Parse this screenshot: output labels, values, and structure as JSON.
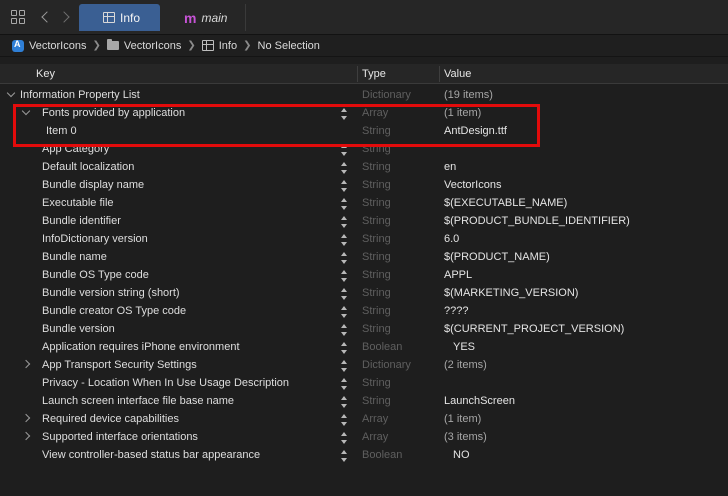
{
  "tabs": [
    {
      "label": "Info",
      "active": true,
      "icon": "table-icon"
    },
    {
      "label": "main",
      "active": false,
      "icon": "m-file-icon",
      "icon_glyph": "m"
    }
  ],
  "breadcrumb": [
    "VectorIcons",
    "VectorIcons",
    "Info",
    "No Selection"
  ],
  "columns": {
    "key": "Key",
    "type": "Type",
    "value": "Value"
  },
  "rows": [
    {
      "key": "Information Property List",
      "type": "Dictionary",
      "value": "(19 items)",
      "level": 0,
      "disclosure": "open"
    },
    {
      "key": "Fonts provided by application",
      "type": "Array",
      "value": "(1 item)",
      "level": 1,
      "disclosure": "open"
    },
    {
      "key": "Item 0",
      "type": "String",
      "value": "AntDesign.ttf",
      "level": 2
    },
    {
      "key": "App Category",
      "type": "String",
      "value": "",
      "level": 1
    },
    {
      "key": "Default localization",
      "type": "String",
      "value": "en",
      "level": 1
    },
    {
      "key": "Bundle display name",
      "type": "String",
      "value": "VectorIcons",
      "level": 1
    },
    {
      "key": "Executable file",
      "type": "String",
      "value": "$(EXECUTABLE_NAME)",
      "level": 1
    },
    {
      "key": "Bundle identifier",
      "type": "String",
      "value": "$(PRODUCT_BUNDLE_IDENTIFIER)",
      "level": 1
    },
    {
      "key": "InfoDictionary version",
      "type": "String",
      "value": "6.0",
      "level": 1
    },
    {
      "key": "Bundle name",
      "type": "String",
      "value": "$(PRODUCT_NAME)",
      "level": 1
    },
    {
      "key": "Bundle OS Type code",
      "type": "String",
      "value": "APPL",
      "level": 1
    },
    {
      "key": "Bundle version string (short)",
      "type": "String",
      "value": "$(MARKETING_VERSION)",
      "level": 1
    },
    {
      "key": "Bundle creator OS Type code",
      "type": "String",
      "value": "????",
      "level": 1
    },
    {
      "key": "Bundle version",
      "type": "String",
      "value": "$(CURRENT_PROJECT_VERSION)",
      "level": 1
    },
    {
      "key": "Application requires iPhone environment",
      "type": "Boolean",
      "value": "YES",
      "level": 1
    },
    {
      "key": "App Transport Security Settings",
      "type": "Dictionary",
      "value": "(2 items)",
      "level": 1,
      "disclosure": "closed"
    },
    {
      "key": "Privacy - Location When In Use Usage Description",
      "type": "String",
      "value": "",
      "level": 1
    },
    {
      "key": "Launch screen interface file base name",
      "type": "String",
      "value": "LaunchScreen",
      "level": 1
    },
    {
      "key": "Required device capabilities",
      "type": "Array",
      "value": "(1 item)",
      "level": 1,
      "disclosure": "closed"
    },
    {
      "key": "Supported interface orientations",
      "type": "Array",
      "value": "(3 items)",
      "level": 1,
      "disclosure": "closed"
    },
    {
      "key": "View controller-based status bar appearance",
      "type": "Boolean",
      "value": "NO",
      "level": 1
    }
  ],
  "colors": {
    "active_tab": "#3a5f93",
    "highlight": "#e30b0b",
    "background": "#1e1e1e"
  }
}
